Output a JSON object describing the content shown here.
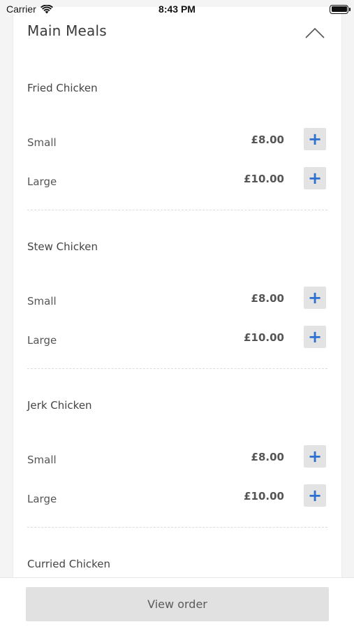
{
  "status_bar": {
    "carrier": "Carrier",
    "time": "8:43 PM"
  },
  "section": {
    "title": "Main Meals"
  },
  "items": [
    {
      "name": "Fried Chicken",
      "options": [
        {
          "size": "Small",
          "price": "£8.00",
          "add_label": "+"
        },
        {
          "size": "Large",
          "price": "£10.00",
          "add_label": "+"
        }
      ]
    },
    {
      "name": "Stew Chicken",
      "options": [
        {
          "size": "Small",
          "price": "£8.00",
          "add_label": "+"
        },
        {
          "size": "Large",
          "price": "£10.00",
          "add_label": "+"
        }
      ]
    },
    {
      "name": "Jerk Chicken",
      "options": [
        {
          "size": "Small",
          "price": "£8.00",
          "add_label": "+"
        },
        {
          "size": "Large",
          "price": "£10.00",
          "add_label": "+"
        }
      ]
    },
    {
      "name": "Curried Chicken",
      "options": []
    }
  ],
  "footer": {
    "view_order_label": "View order"
  },
  "colors": {
    "accent": "#2f6fd0",
    "button_bg": "#e3e3e3",
    "page_bg": "#f4f4f4"
  }
}
